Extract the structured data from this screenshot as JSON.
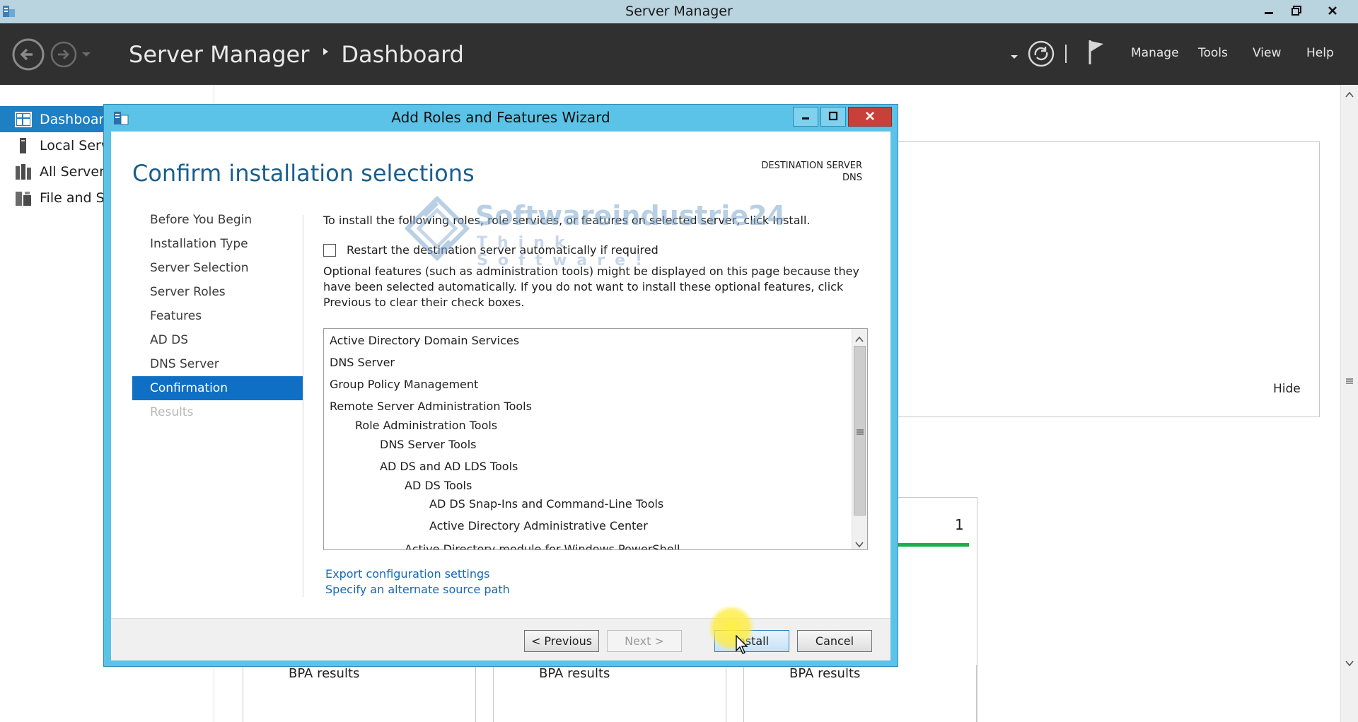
{
  "window": {
    "title": "Server Manager"
  },
  "header": {
    "breadcrumb_app": "Server Manager",
    "breadcrumb_page": "Dashboard",
    "menu": [
      "Manage",
      "Tools",
      "View",
      "Help"
    ]
  },
  "nav": {
    "items": [
      {
        "label": "Dashboard",
        "icon": "dashboard-icon",
        "active": true
      },
      {
        "label": "Local Serv",
        "icon": "local-server-icon"
      },
      {
        "label": "All Servers",
        "icon": "all-servers-icon"
      },
      {
        "label": "File and St",
        "icon": "file-storage-icon"
      }
    ]
  },
  "dashboard": {
    "hide_label": "Hide",
    "tile_count": "1",
    "bpa_label": "BPA results"
  },
  "wizard": {
    "title": "Add Roles and Features Wizard",
    "heading": "Confirm installation selections",
    "destination_label": "DESTINATION SERVER",
    "destination_value": "DNS",
    "steps": [
      {
        "label": "Before You Begin"
      },
      {
        "label": "Installation Type"
      },
      {
        "label": "Server Selection"
      },
      {
        "label": "Server Roles"
      },
      {
        "label": "Features"
      },
      {
        "label": "AD DS"
      },
      {
        "label": "DNS Server"
      },
      {
        "label": "Confirmation",
        "current": true
      },
      {
        "label": "Results",
        "disabled": true
      }
    ],
    "intro": "To install the following roles, role services, or features on selected server, click Install.",
    "restart_label": "Restart the destination server automatically if required",
    "restart_checked": false,
    "optional_text": "Optional features (such as administration tools) might be displayed on this page because they have been selected automatically. If you do not want to install these optional features, click Previous to clear their check boxes.",
    "features": [
      {
        "label": "Active Directory Domain Services",
        "level": 0
      },
      {
        "label": "DNS Server",
        "level": 0
      },
      {
        "label": "Group Policy Management",
        "level": 0
      },
      {
        "label": "Remote Server Administration Tools",
        "level": 0
      },
      {
        "label": "Role Administration Tools",
        "level": 1
      },
      {
        "label": "DNS Server Tools",
        "level": 2
      },
      {
        "label": "AD DS and AD LDS Tools",
        "level": 2
      },
      {
        "label": "AD DS Tools",
        "level": 3
      },
      {
        "label": "AD DS Snap-Ins and Command-Line Tools",
        "level": 4
      },
      {
        "label": "Active Directory Administrative Center",
        "level": 4
      },
      {
        "label": "Active Directory module for Windows PowerShell",
        "level": 3
      }
    ],
    "export_link": "Export configuration settings",
    "alt_source_link": "Specify an alternate source path",
    "buttons": {
      "previous": "< Previous",
      "next": "Next >",
      "install": "Install",
      "cancel": "Cancel"
    }
  },
  "watermark": {
    "brand": "Softwareindustrie24",
    "tagline": "Think Software!"
  }
}
